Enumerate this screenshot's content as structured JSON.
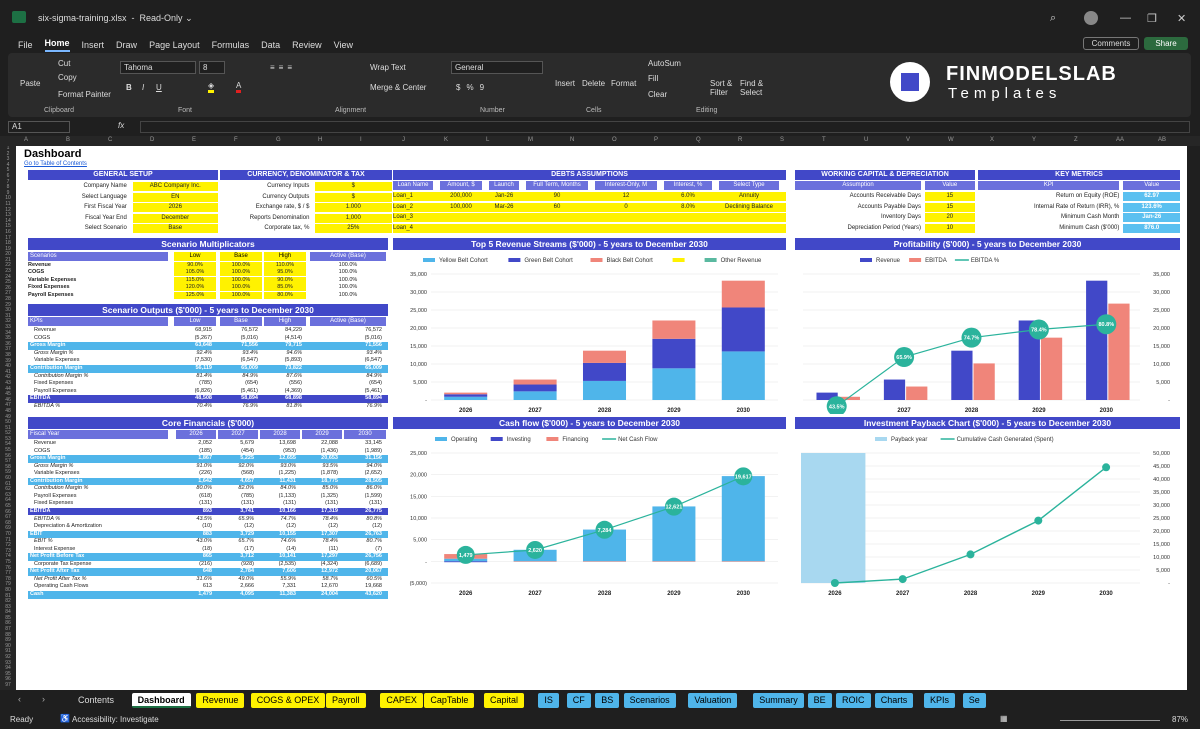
{
  "title_bar": {
    "filename": "six-sigma-training.xlsx",
    "mode": "Read-Only"
  },
  "menu": [
    "File",
    "Home",
    "Insert",
    "Draw",
    "Page Layout",
    "Formulas",
    "Data",
    "Review",
    "View"
  ],
  "menu_active": "Home",
  "actions": {
    "comments": "Comments",
    "share": "Share"
  },
  "ribbon": {
    "clipboard": {
      "label": "Clipboard",
      "paste": "Paste",
      "cut": "Cut",
      "copy": "Copy",
      "format_painter": "Format Painter"
    },
    "font": {
      "label": "Font",
      "family": "Tahoma",
      "size": "8"
    },
    "alignment": {
      "label": "Alignment",
      "wrap": "Wrap Text",
      "merge": "Merge & Center"
    },
    "number": {
      "label": "Number",
      "format": "General"
    },
    "cells": {
      "label": "Cells",
      "insert": "Insert",
      "delete": "Delete",
      "format": "Format"
    },
    "editing": {
      "label": "Editing",
      "autosum": "AutoSum",
      "fill": "Fill",
      "clear": "Clear",
      "sort": "Sort & Filter",
      "find": "Find & Select"
    }
  },
  "logo": {
    "name": "FINMODELSLAB",
    "sub": "Templates"
  },
  "formula_bar": {
    "cell": "A1",
    "fx": "fx"
  },
  "columns": [
    "A",
    "B",
    "C",
    "D",
    "E",
    "F",
    "G",
    "H",
    "I",
    "J",
    "K",
    "L",
    "M",
    "N",
    "O",
    "P",
    "Q",
    "R",
    "S",
    "T",
    "U",
    "V",
    "W",
    "X",
    "Y",
    "Z",
    "AA",
    "AB"
  ],
  "sheet": {
    "title": "Dashboard",
    "toc": "Go to Table of Contents",
    "general": {
      "title": "GENERAL SETUP",
      "rows": [
        [
          "Company Name",
          "ABC Company Inc."
        ],
        [
          "Select Language",
          "EN"
        ],
        [
          "First Fiscal Year",
          "2026"
        ],
        [
          "Fiscal Year End",
          "December"
        ],
        [
          "Select Scenario",
          "Base"
        ]
      ]
    },
    "currency": {
      "title": "CURRENCY, DENOMINATOR & TAX",
      "rows": [
        [
          "Currency Inputs",
          "$"
        ],
        [
          "Currency Outputs",
          "$"
        ],
        [
          "Exchange rate, $ / $",
          "1.000"
        ],
        [
          "Reports Denomination",
          "1,000"
        ],
        [
          "Corporate tax, %",
          "25%"
        ]
      ]
    },
    "debts": {
      "title": "DEBTS ASSUMPTIONS",
      "headers": [
        "Loan Name",
        "Amount, $",
        "Launch",
        "Full Term, Months",
        "Interest-Only, M",
        "Interest, %",
        "Select Type"
      ],
      "rows": [
        [
          "Loan_1",
          "200,000",
          "Jan-26",
          "90",
          "12",
          "6.0%",
          "Annuity"
        ],
        [
          "Loan_2",
          "100,000",
          "Mar-26",
          "60",
          "0",
          "8.0%",
          "Declining Balance"
        ],
        [
          "Loan_3",
          "",
          "",
          "",
          "",
          "",
          ""
        ],
        [
          "Loan_4",
          "",
          "",
          "",
          "",
          "",
          ""
        ]
      ]
    },
    "wc": {
      "title": "WORKING CAPITAL & DEPRECIATION",
      "headers": [
        "Assumption",
        "Value"
      ],
      "rows": [
        [
          "Accounts Receivable Days",
          "15"
        ],
        [
          "Accounts Payable Days",
          "15"
        ],
        [
          "Inventory Days",
          "20"
        ],
        [
          "Depreciation Period (Years)",
          "10"
        ]
      ]
    },
    "kpi": {
      "title": "KEY METRICS",
      "headers": [
        "KPI",
        "Value"
      ],
      "rows": [
        [
          "Return on Equity (ROE)",
          "62.97"
        ],
        [
          "Internal Rate of Return (IRR), %",
          "123.6%"
        ],
        [
          "Minimum Cash Month",
          "Jan-26"
        ],
        [
          "Minimum Cash ($'000)",
          "876.0"
        ]
      ]
    },
    "scen_mult": {
      "title": "Scenario Multiplicators",
      "headers": [
        "Scenarios",
        "Low",
        "Base",
        "High",
        "Active (Base)"
      ],
      "rows": [
        [
          "Revenue",
          "90.0%",
          "100.0%",
          "110.0%",
          "100.0%"
        ],
        [
          "COGS",
          "105.0%",
          "100.0%",
          "95.0%",
          "100.0%"
        ],
        [
          "Variable Expenses",
          "115.0%",
          "100.0%",
          "90.0%",
          "100.0%"
        ],
        [
          "Fixed Expenses",
          "120.0%",
          "100.0%",
          "85.0%",
          "100.0%"
        ],
        [
          "Payroll Expenses",
          "125.0%",
          "100.0%",
          "80.0%",
          "100.0%"
        ]
      ]
    },
    "scen_out": {
      "title": "Scenario Outputs ($'000) - 5 years to December 2030",
      "headers": [
        "KPIs",
        "Low",
        "Base",
        "High",
        "Active (Base)"
      ],
      "rows": [
        [
          "Revenue",
          "68,915",
          "76,572",
          "84,229",
          "76,572",
          ""
        ],
        [
          "COGS",
          "(5,267)",
          "(5,016)",
          "(4,514)",
          "(5,016)",
          ""
        ],
        [
          "Gross Margin",
          "63,648",
          "71,556",
          "79,715",
          "71,556",
          "band"
        ],
        [
          "Gross Margin %",
          "92.4%",
          "93.4%",
          "94.6%",
          "93.4%",
          "it"
        ],
        [
          "Variable Expenses",
          "(7,530)",
          "(6,547)",
          "(5,893)",
          "(6,547)",
          ""
        ],
        [
          "Contribution Margin",
          "56,119",
          "65,009",
          "73,822",
          "65,009",
          "band"
        ],
        [
          "Contribution Margin %",
          "81.4%",
          "84.9%",
          "87.6%",
          "84.9%",
          "it"
        ],
        [
          "Fixed Expenses",
          "(785)",
          "(654)",
          "(556)",
          "(654)",
          ""
        ],
        [
          "Payroll Expenses",
          "(6,826)",
          "(5,461)",
          "(4,369)",
          "(5,461)",
          ""
        ],
        [
          "EBITDA",
          "48,508",
          "58,894",
          "68,898",
          "58,894",
          "band2"
        ],
        [
          "EBITDA %",
          "70.4%",
          "76.9%",
          "81.8%",
          "76.9%",
          "it"
        ]
      ]
    },
    "core": {
      "title": "Core Financials ($'000)",
      "headers": [
        "Fiscal Year",
        "2026",
        "2027",
        "2028",
        "2029",
        "2030"
      ],
      "rows": [
        [
          "Revenue",
          "2,052",
          "5,679",
          "13,698",
          "22,088",
          "33,145",
          ""
        ],
        [
          "COGS",
          "(185)",
          "(454)",
          "(953)",
          "(1,436)",
          "(1,989)",
          ""
        ],
        [
          "Gross Margin",
          "1,867",
          "5,225",
          "12,655",
          "20,653",
          "31,156",
          "band"
        ],
        [
          "Gross Margin %",
          "91.0%",
          "92.0%",
          "93.0%",
          "93.5%",
          "94.0%",
          "it"
        ],
        [
          "Variable Expenses",
          "(226)",
          "(568)",
          "(1,225)",
          "(1,878)",
          "(2,652)",
          ""
        ],
        [
          "Contribution Margin",
          "1,642",
          "4,657",
          "11,431",
          "18,775",
          "28,505",
          "band"
        ],
        [
          "Contribution Margin %",
          "80.0%",
          "82.0%",
          "84.0%",
          "85.0%",
          "86.0%",
          "it"
        ],
        [
          "Payroll Expenses",
          "(618)",
          "(785)",
          "(1,133)",
          "(1,325)",
          "(1,599)",
          ""
        ],
        [
          "Fixed Expenses",
          "(131)",
          "(131)",
          "(131)",
          "(131)",
          "(131)",
          ""
        ],
        [
          "EBITDA",
          "893",
          "3,741",
          "10,166",
          "17,319",
          "26,775",
          "band2"
        ],
        [
          "EBITDA %",
          "43.5%",
          "65.9%",
          "74.7%",
          "78.4%",
          "80.8%",
          "it"
        ],
        [
          "Depreciation & Amortization",
          "(10)",
          "(12)",
          "(12)",
          "(12)",
          "(12)",
          ""
        ],
        [
          "EBIT",
          "883",
          "3,729",
          "10,155",
          "17,307",
          "26,763",
          "band"
        ],
        [
          "EBIT %",
          "43.0%",
          "65.7%",
          "74.6%",
          "78.4%",
          "80.7%",
          "it"
        ],
        [
          "Interest Expense",
          "(18)",
          "(17)",
          "(14)",
          "(11)",
          "(7)",
          ""
        ],
        [
          "Net Profit Before Tax",
          "865",
          "3,712",
          "10,141",
          "17,297",
          "26,756",
          "band"
        ],
        [
          "Corporate Tax Expense",
          "(216)",
          "(928)",
          "(2,535)",
          "(4,324)",
          "(6,689)",
          ""
        ],
        [
          "Net Profit After Tax",
          "648",
          "2,784",
          "7,606",
          "12,972",
          "20,067",
          "band"
        ],
        [
          "Net Profit After Tax %",
          "31.6%",
          "49.0%",
          "55.9%",
          "58.7%",
          "60.5%",
          "it"
        ],
        [
          "Operating Cash Flows",
          "613",
          "2,666",
          "7,331",
          "12,670",
          "19,668",
          ""
        ],
        [
          "Cash",
          "1,479",
          "4,095",
          "11,383",
          "24,004",
          "43,620",
          "band"
        ]
      ]
    }
  },
  "charts": {
    "revenue": {
      "title": "Top 5 Revenue Streams ($'000) - 5 years to December 2030"
    },
    "profit": {
      "title": "Profitability ($'000) - 5 years to December 2030"
    },
    "cash": {
      "title": "Cash flow ($'000) - 5 years to December 2030"
    },
    "payback": {
      "title": "Investment Payback Chart ($'000) - 5 years to December 2030"
    }
  },
  "chart_data": [
    {
      "type": "bar",
      "title": "Top 5 Revenue Streams ($'000) - 5 years to December 2030",
      "categories": [
        "2026",
        "2027",
        "2028",
        "2029",
        "2030"
      ],
      "ylim": [
        0,
        35000
      ],
      "yticks": [
        "35,000",
        "30,000",
        "25,000",
        "20,000",
        "15,000",
        "10,000",
        "5,000",
        "-"
      ],
      "series": [
        {
          "name": "Yellow Belt Cohort",
          "color": "#4fb5ea",
          "values": [
            900,
            2400,
            5300,
            8800,
            13500
          ]
        },
        {
          "name": "Green Belt Cohort",
          "color": "#4148c8",
          "values": [
            700,
            1900,
            5000,
            8200,
            12200
          ]
        },
        {
          "name": "Black Belt Cohort",
          "color": "#f0857a",
          "values": [
            452,
            1379,
            3398,
            5088,
            7445
          ]
        },
        {
          "name": "",
          "color": "#fff200",
          "values": [
            0,
            0,
            0,
            0,
            0
          ]
        },
        {
          "name": "Other Revenue",
          "color": "#5ab9a0",
          "values": [
            0,
            0,
            0,
            0,
            0
          ]
        }
      ]
    },
    {
      "type": "bar",
      "title": "Profitability ($'000) - 5 years to December 2030",
      "categories": [
        "2026",
        "2027",
        "2028",
        "2029",
        "2030"
      ],
      "ylim": [
        0,
        35000
      ],
      "yticks": [
        "35,000",
        "30,000",
        "25,000",
        "20,000",
        "15,000",
        "10,000",
        "5,000",
        "-"
      ],
      "series": [
        {
          "name": "Revenue",
          "color": "#4148c8",
          "values": [
            2052,
            5679,
            13698,
            22088,
            33145
          ]
        },
        {
          "name": "EBITDA",
          "color": "#f0857a",
          "values": [
            893,
            3741,
            10166,
            17319,
            26775
          ]
        },
        {
          "name": "EBITDA %",
          "color": "#2bb39c",
          "values": [
            43.5,
            65.9,
            74.7,
            78.4,
            80.8
          ],
          "labels": [
            "43.5%",
            "65.9%",
            "74.7%",
            "78.4%",
            "80.8%"
          ]
        }
      ]
    },
    {
      "type": "bar",
      "title": "Cash flow ($'000) - 5 years to December 2030",
      "categories": [
        "2026",
        "2027",
        "2028",
        "2029",
        "2030"
      ],
      "ylim": [
        -5000,
        25000
      ],
      "yticks": [
        "25,000",
        "20,000",
        "15,000",
        "10,000",
        "5,000",
        "-",
        "(5,000)"
      ],
      "series": [
        {
          "name": "Operating",
          "color": "#4fb5ea",
          "values": [
            613,
            2666,
            7331,
            12670,
            19668
          ]
        },
        {
          "name": "Investing",
          "color": "#4148c8",
          "values": [
            -200,
            0,
            0,
            0,
            0
          ]
        },
        {
          "name": "Financing",
          "color": "#f0857a",
          "values": [
            1066,
            -50,
            -43,
            -49,
            -52
          ]
        },
        {
          "name": "Net Cash Flow",
          "color": "#2bb39c",
          "values": [
            1479,
            2620,
            7284,
            12621,
            19617
          ],
          "labels": [
            "1,479",
            "2,620",
            "7,284",
            "12,621",
            "19,617"
          ]
        }
      ]
    },
    {
      "type": "line",
      "title": "Investment Payback Chart ($'000) - 5 years to December 2030",
      "categories": [
        "2026",
        "2027",
        "2028",
        "2029",
        "2030"
      ],
      "ylim": [
        0,
        50000
      ],
      "yticks": [
        "50,000",
        "45,000",
        "40,000",
        "35,000",
        "30,000",
        "25,000",
        "20,000",
        "15,000",
        "10,000",
        "5,000",
        "-"
      ],
      "series": [
        {
          "name": "Payback year",
          "color": "#a8d8f0",
          "values": [
            50000,
            0,
            0,
            0,
            0
          ]
        },
        {
          "name": "Cumulative Cash Generated (Spent)",
          "color": "#2bb39c",
          "values": [
            0,
            1500,
            11000,
            24000,
            44500
          ]
        }
      ]
    }
  ],
  "tabs": [
    {
      "label": "Contents",
      "color": "none"
    },
    {
      "label": "Dashboard",
      "color": "#ffffff"
    },
    {
      "label": "Revenue",
      "color": "#fff200"
    },
    {
      "label": "COGS & OPEX",
      "color": "#fff200"
    },
    {
      "label": "Payroll",
      "color": "#fff200"
    },
    {
      "label": "CAPEX",
      "color": "#fff200"
    },
    {
      "label": "CapTable",
      "color": "#fff200"
    },
    {
      "label": "Capital",
      "color": "#fff200"
    },
    {
      "label": "IS",
      "color": "#4fb5ea"
    },
    {
      "label": "CF",
      "color": "#4fb5ea"
    },
    {
      "label": "BS",
      "color": "#4fb5ea"
    },
    {
      "label": "Scenarios",
      "color": "#4fb5ea"
    },
    {
      "label": "Valuation",
      "color": "#4fb5ea"
    },
    {
      "label": "Summary",
      "color": "#4fb5ea"
    },
    {
      "label": "BE",
      "color": "#4fb5ea"
    },
    {
      "label": "ROIC",
      "color": "#4fb5ea"
    },
    {
      "label": "Charts",
      "color": "#4fb5ea"
    },
    {
      "label": "KPIs",
      "color": "#4fb5ea"
    },
    {
      "label": "Se",
      "color": "#4fb5ea"
    }
  ],
  "status": {
    "ready": "Ready",
    "accessibility": "Accessibility: Investigate",
    "zoom": "87%"
  }
}
